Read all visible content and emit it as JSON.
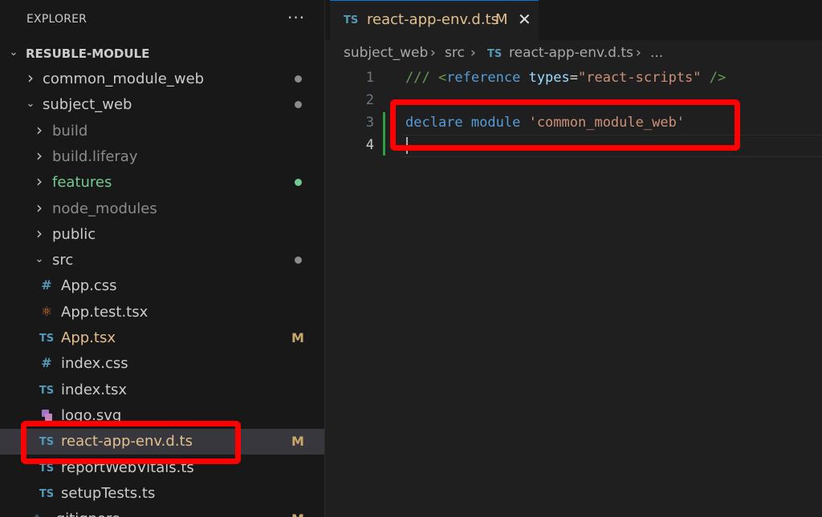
{
  "colors": {
    "highlight": "#ff0000",
    "modified": "#e2c08d",
    "ts_icon": "#519aba",
    "keyword": "#569cd6",
    "string": "#ce9178",
    "comment": "#6a9955"
  },
  "explorer": {
    "title": "EXPLORER",
    "more_icon": "···",
    "root": "RESUBLE-MODULE"
  },
  "tree": [
    {
      "label": "common_module_web",
      "kind": "folder",
      "expanded": false,
      "color": "#cccccc",
      "dot": "#8b8b8b"
    },
    {
      "label": "subject_web",
      "kind": "folder",
      "expanded": true,
      "color": "#cccccc",
      "dot": "#8b8b8b"
    },
    {
      "label": "build",
      "kind": "folder",
      "expanded": false,
      "color": "#8c8c8c"
    },
    {
      "label": "build.liferay",
      "kind": "folder",
      "expanded": false,
      "color": "#8c8c8c"
    },
    {
      "label": "features",
      "kind": "folder",
      "expanded": false,
      "color": "#73c991",
      "dot": "#73c991"
    },
    {
      "label": "node_modules",
      "kind": "folder",
      "expanded": false,
      "color": "#8c8c8c"
    },
    {
      "label": "public",
      "kind": "folder",
      "expanded": false,
      "color": "#cccccc"
    },
    {
      "label": "src",
      "kind": "folder",
      "expanded": true,
      "color": "#cccccc",
      "dot": "#8b8b8b"
    },
    {
      "label": "App.css",
      "kind": "file",
      "icon": "#",
      "icon_name": "css-icon",
      "color": "#cccccc"
    },
    {
      "label": "App.test.tsx",
      "kind": "file",
      "icon": "⚛",
      "icon_name": "react-test-icon",
      "color": "#cccccc"
    },
    {
      "label": "App.tsx",
      "kind": "file",
      "icon": "TS",
      "icon_name": "typescript-icon",
      "color": "#e2c08d",
      "status": "M"
    },
    {
      "label": "index.css",
      "kind": "file",
      "icon": "#",
      "icon_name": "css-icon",
      "color": "#cccccc"
    },
    {
      "label": "index.tsx",
      "kind": "file",
      "icon": "TS",
      "icon_name": "typescript-icon",
      "color": "#cccccc"
    },
    {
      "label": "logo.svg",
      "kind": "file",
      "icon": "svg",
      "icon_name": "svg-file-icon",
      "color": "#cccccc"
    },
    {
      "label": "react-app-env.d.ts",
      "kind": "file",
      "icon": "TS",
      "icon_name": "typescript-icon",
      "color": "#e2c08d",
      "status": "M",
      "selected": true
    },
    {
      "label": "reportWebVitals.ts",
      "kind": "file",
      "icon": "TS",
      "icon_name": "typescript-icon",
      "color": "#cccccc"
    },
    {
      "label": "setupTests.ts",
      "kind": "file",
      "icon": "TS",
      "icon_name": "typescript-icon",
      "color": "#cccccc"
    },
    {
      "label": ".gitignore",
      "kind": "file",
      "icon": "◆",
      "icon_name": "git-icon",
      "color": "#cccccc",
      "status": "M"
    }
  ],
  "tab": {
    "icon": "TS",
    "label": "react-app-env.d.ts",
    "status": "M",
    "close_icon": "✕"
  },
  "breadcrumb": {
    "parts": [
      "subject_web",
      "src"
    ],
    "file_icon": "TS",
    "file": "react-app-env.d.ts",
    "sep": "›",
    "ellipsis": "..."
  },
  "code": {
    "line_numbers": [
      "1",
      "2",
      "3",
      "4"
    ],
    "line1": {
      "p1": "/// <",
      "tag": "reference",
      "attr": "types",
      "eq": "=",
      "val": "\"react-scripts\"",
      "end": " />"
    },
    "line3": {
      "kw1": "declare",
      "kw2": "module",
      "str": "'common_module_web'"
    }
  }
}
